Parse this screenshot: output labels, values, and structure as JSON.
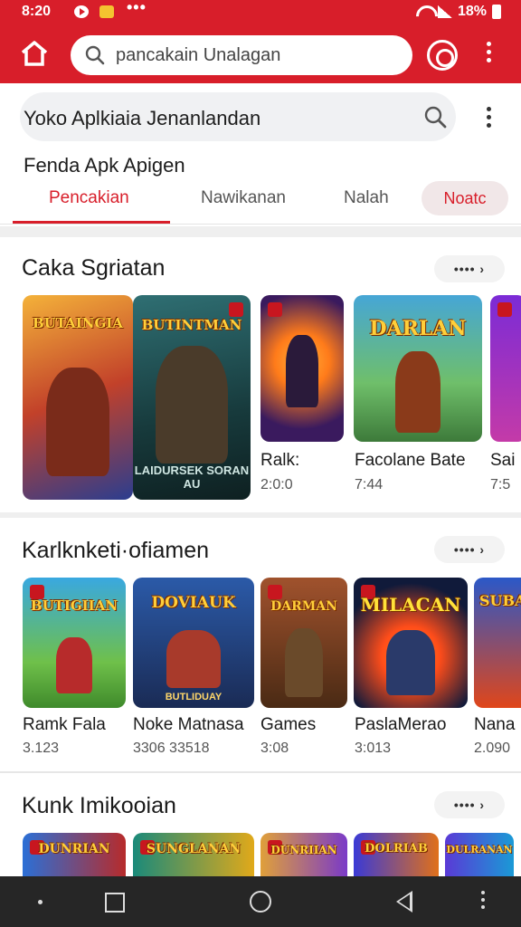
{
  "status": {
    "time": "8:20",
    "battery": "18%",
    "dots": "•••"
  },
  "search": {
    "text": "pancakain Unalagan"
  },
  "page": {
    "search_text": "Yoko Aplkiaia Jenanlandan",
    "subtitle": "Fenda Apk Apigen"
  },
  "tabs": [
    {
      "label": "Pencakian",
      "active": true
    },
    {
      "label": "Nawikanan",
      "active": false
    },
    {
      "label": "Nalah",
      "active": false
    },
    {
      "label": "Noatc",
      "active": false
    }
  ],
  "sections": [
    {
      "title": "Caka Sgriatan",
      "more": "•••• ›",
      "items": [
        {
          "name": "",
          "sub": "",
          "banner": "BUTAINGIA",
          "caption": "",
          "colors": [
            "#f4b23a",
            "#2b3d8f"
          ]
        },
        {
          "name": "",
          "sub": "",
          "banner": "BUTINTMAN",
          "caption": "LAIDURSEK SORAN AU",
          "colors": [
            "#2f6f73",
            "#173a3c"
          ]
        },
        {
          "name": "Ralk:",
          "sub": "2:0:0",
          "banner": "",
          "caption": "",
          "colors": [
            "#ff7b1a",
            "#3a1a5e"
          ]
        },
        {
          "name": "Facolane Bate",
          "sub": "7:44",
          "banner": "DARLAN",
          "caption": "",
          "colors": [
            "#46a6d6",
            "#3d7a3a"
          ]
        },
        {
          "name": "Sai",
          "sub": "7:5",
          "banner": "",
          "caption": "",
          "colors": [
            "#7b2bd6",
            "#c43aa8"
          ]
        }
      ]
    },
    {
      "title": "Karlknketi·ofiamen",
      "more": "•••• ›",
      "items": [
        {
          "name": "Ramk Fala",
          "sub": "3.123",
          "banner": "BUTIGIIAN",
          "caption": "",
          "colors": [
            "#39a8e0",
            "#3f8a2b"
          ]
        },
        {
          "name": "Noke Matnasa",
          "sub": "3306 33518",
          "banner": "DOVIAUK",
          "caption": "BUTLIDUAY",
          "colors": [
            "#2b5aa8",
            "#1a2b55"
          ]
        },
        {
          "name": "Games",
          "sub": "3:08",
          "banner": "DARMAN",
          "caption": "",
          "colors": [
            "#a0522d",
            "#4a2a14"
          ]
        },
        {
          "name": "PaslaMerao",
          "sub": "3:013",
          "banner": "MILACAN",
          "caption": "",
          "colors": [
            "#ff4d1a",
            "#101a3a"
          ]
        },
        {
          "name": "Nana",
          "sub": "2.090",
          "banner": "SUBA",
          "caption": "",
          "colors": [
            "#e0461a",
            "#2b58c8"
          ]
        }
      ]
    },
    {
      "title": "Kunk Imikooian",
      "more": "•••• ›",
      "items": [
        {
          "banner": "DUNRIAN",
          "colors": [
            "#2b6fd6",
            "#b72b2b"
          ]
        },
        {
          "banner": "SUNGLANAN",
          "colors": [
            "#1a8a7a",
            "#e0a91a"
          ]
        },
        {
          "banner": "DUNRIIAN",
          "colors": [
            "#e0a03a",
            "#7a3ac8"
          ]
        },
        {
          "banner": "DOLRIAB",
          "colors": [
            "#3a3ad6",
            "#e0701a"
          ]
        },
        {
          "banner": "DULRANAN",
          "colors": [
            "#5a3ad6",
            "#1a9ad6"
          ]
        }
      ]
    }
  ]
}
